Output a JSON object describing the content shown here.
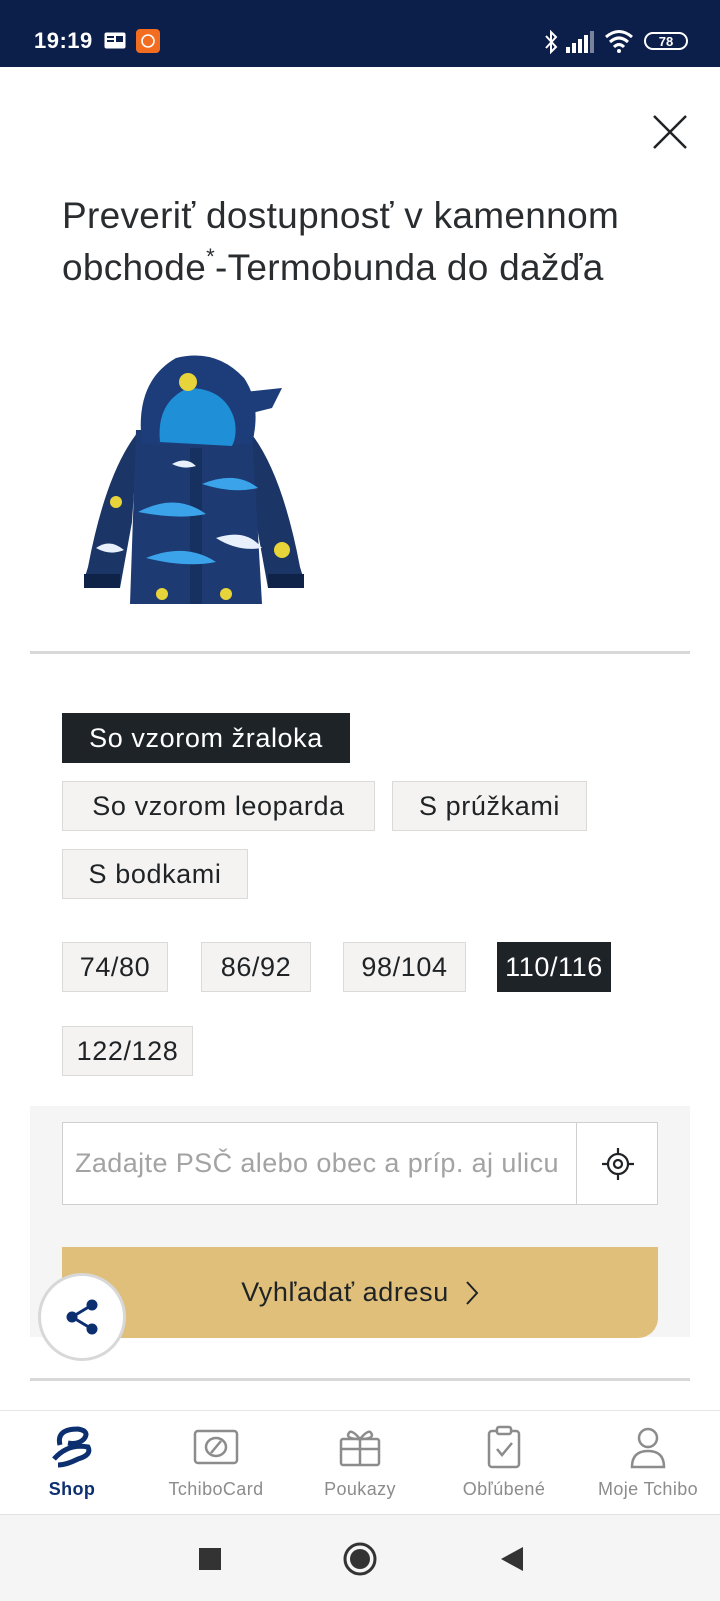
{
  "status_bar": {
    "time": "19:19",
    "battery": "78",
    "icons": [
      "gallery-icon",
      "mi-app-icon",
      "bluetooth-icon",
      "signal-icon",
      "wifi-icon",
      "battery-icon"
    ]
  },
  "dialog": {
    "title": "Preveriť dostupnosť v kamennom obchode",
    "title_sup": "*",
    "title_suffix": "-Termobunda do dažďa",
    "close_icon": "close-icon",
    "product_image": "rain-jacket-shark-pattern"
  },
  "patterns": [
    {
      "label": "So vzorom žraloka",
      "selected": true
    },
    {
      "label": "So vzorom leoparda",
      "selected": false
    },
    {
      "label": "S prúžkami",
      "selected": false
    },
    {
      "label": "S bodkami",
      "selected": false
    }
  ],
  "sizes": [
    {
      "label": "74/80",
      "selected": false
    },
    {
      "label": "86/92",
      "selected": false
    },
    {
      "label": "98/104",
      "selected": false
    },
    {
      "label": "110/116",
      "selected": true
    },
    {
      "label": "122/128",
      "selected": false
    }
  ],
  "search": {
    "placeholder": "Zadajte PSČ alebo obec a príp. aj ulicu",
    "value": "",
    "locate_icon": "crosshair-icon",
    "button_label": "Vyhľadať adresu"
  },
  "share_icon": "share-icon",
  "bottom_nav": [
    {
      "label": "Shop",
      "icon": "tchibo-logo-icon",
      "active": true
    },
    {
      "label": "TchiboCard",
      "icon": "card-icon",
      "active": false
    },
    {
      "label": "Poukazy",
      "icon": "gift-icon",
      "active": false
    },
    {
      "label": "Obľúbené",
      "icon": "clipboard-check-icon",
      "active": false
    },
    {
      "label": "Moje Tchibo",
      "icon": "user-icon",
      "active": false
    }
  ],
  "colors": {
    "status_bar": "#0c1f4a",
    "selected_chip": "#1e2328",
    "chip_bg": "#f4f3f1",
    "search_button": "#dfbf7a",
    "nav_active": "#0c2f6f",
    "nav_inactive": "#8c8c8c"
  }
}
